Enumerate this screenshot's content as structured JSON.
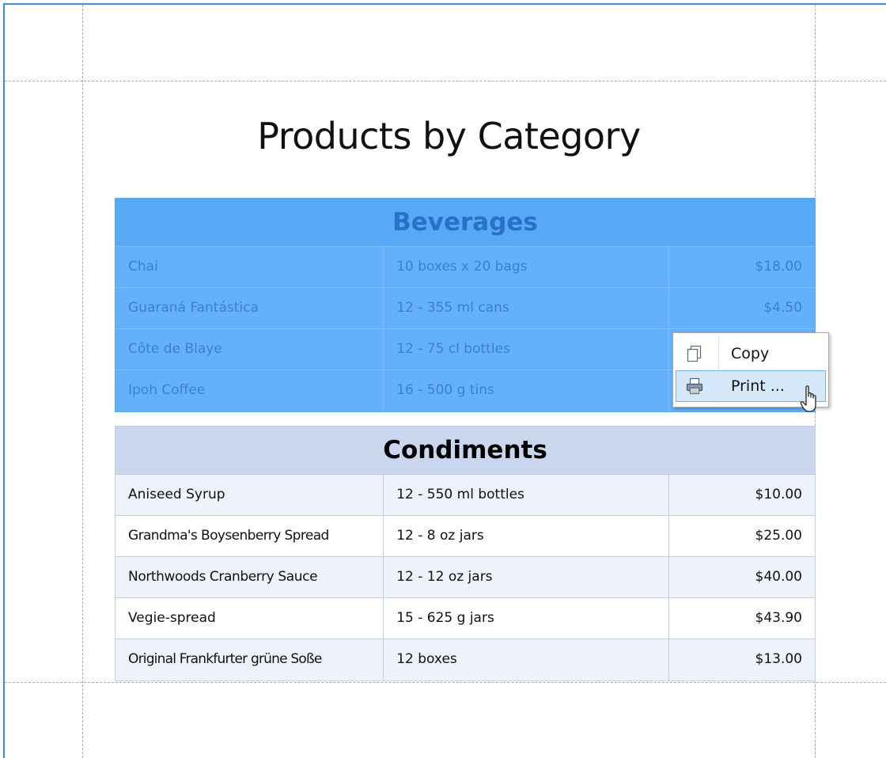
{
  "report": {
    "title": "Products by Category"
  },
  "groups": [
    {
      "name": "Beverages",
      "rows": [
        {
          "product": "Chai",
          "quantity": "10 boxes x 20 bags",
          "price": "$18.00"
        },
        {
          "product": "Guaraná Fantástica",
          "quantity": "12 - 355 ml cans",
          "price": "$4.50"
        },
        {
          "product": "Côte de Blaye",
          "quantity": "12 - 75 cl bottles",
          "price": ""
        },
        {
          "product": "Ipoh Coffee",
          "quantity": "16 - 500 g tins",
          "price": ""
        }
      ]
    },
    {
      "name": "Condiments",
      "rows": [
        {
          "product": "Aniseed Syrup",
          "quantity": "12 - 550 ml bottles",
          "price": "$10.00"
        },
        {
          "product": "Grandma's Boysenberry Spread",
          "quantity": "12 - 8 oz jars",
          "price": "$25.00"
        },
        {
          "product": "Northwoods Cranberry Sauce",
          "quantity": "12 - 12 oz jars",
          "price": "$40.00"
        },
        {
          "product": "Vegie-spread",
          "quantity": "15 - 625 g jars",
          "price": "$43.90"
        },
        {
          "product": "Original Frankfurter grüne Soße",
          "quantity": "12 boxes",
          "price": "$13.00"
        }
      ]
    }
  ],
  "context_menu": {
    "items": [
      {
        "label": "Copy",
        "icon": "copy-icon"
      },
      {
        "label": "Print ...",
        "icon": "printer-icon",
        "hovered": true
      }
    ]
  },
  "colors": {
    "frame": "#3d8fd6",
    "selection_fill": "#65b0fb",
    "selection_header": "#58a8f8",
    "condiments_header": "#cad6ee",
    "menu_hover": "#d5e8fa"
  }
}
